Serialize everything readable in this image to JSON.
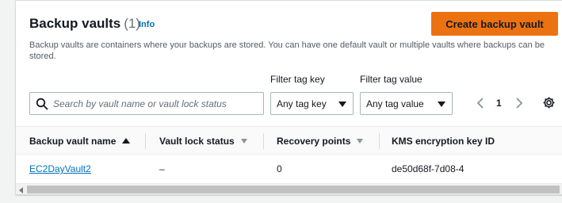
{
  "header": {
    "title": "Backup vaults",
    "count": "(1)",
    "info": "Info",
    "create_button": "Create backup vault",
    "description": "Backup vaults are containers where your backups are stored. You can have one default vault or multiple vaults where backups can be stored."
  },
  "filters": {
    "search_placeholder": "Search by vault name or vault lock status",
    "tag_key_label": "Filter tag key",
    "tag_key_value": "Any tag key",
    "tag_value_label": "Filter tag value",
    "tag_value_value": "Any tag value"
  },
  "pagination": {
    "current_page": "1"
  },
  "table": {
    "columns": [
      "Backup vault name",
      "Vault lock status",
      "Recovery points",
      "KMS encryption key ID"
    ],
    "sorted_column": "Backup vault name",
    "rows": [
      {
        "name": "EC2DayVault2",
        "lock_status": "–",
        "recovery_points": "0",
        "kms_key": "de50d68f-7d08-4"
      }
    ]
  },
  "colors": {
    "accent": "#ec7211",
    "link": "#0073bb",
    "text": "#16191f"
  },
  "icons": [
    "search-icon",
    "caret-down-icon",
    "chevron-left-icon",
    "chevron-right-icon",
    "gear-icon",
    "sort-ascending-icon",
    "sort-icon"
  ]
}
